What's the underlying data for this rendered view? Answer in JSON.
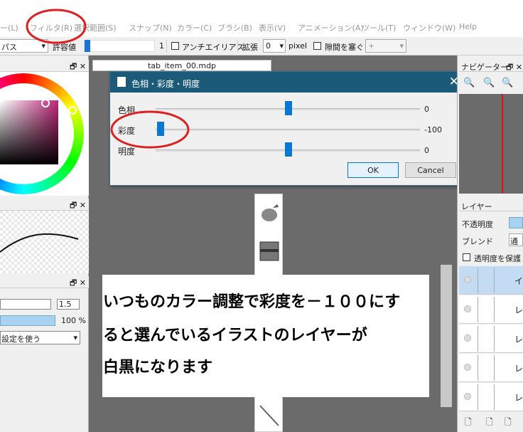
{
  "menubar": {
    "items": [
      "ー(L)",
      "フィルタ(R)",
      "選択範囲(S)",
      "スナップ(N)",
      "カラー(C)",
      "ブラシ(B)",
      "表示(V)",
      "アニメーション(A)",
      "ツール(T)",
      "ウィンドウ(W)",
      "Help"
    ]
  },
  "toolbar": {
    "mode_value": "パス",
    "tolerance_label": "許容値",
    "tolerance_value": "1",
    "antialias_label": "アンチエイリアス",
    "expand_label": "拡張",
    "expand_value": "0",
    "unit": "pixel",
    "gap_label": "隙間を塞ぐ",
    "gap_value": "+"
  },
  "left_panels": {
    "panel1_buttons": "🗗 ✕",
    "panel2_buttons": "🗗 ✕",
    "panel3_buttons": "🗗 ✕",
    "brush_size_value": "1.5",
    "opacity_value": "100 %",
    "setting_value": "設定を使う"
  },
  "document": {
    "tab_title": "tab_item_00.mdp"
  },
  "dialog": {
    "title": "色相・彩度・明度",
    "close_glyph": "✕",
    "rows": [
      {
        "label": "色相",
        "value": "0",
        "position": 0.5
      },
      {
        "label": "彩度",
        "value": "-100",
        "position": 0.0
      },
      {
        "label": "明度",
        "value": "0",
        "position": 0.5
      }
    ],
    "ok_label": "OK",
    "cancel_label": "Cancel"
  },
  "annotation": {
    "line1": "いつものカラー調整で彩度を－１００にす",
    "line2": "ると選んでいるイラストのレイヤーが",
    "line3": "白黒になります"
  },
  "right_panels": {
    "navigator_title": "ナビゲーター",
    "navigator_buttons": "🗗 ✕",
    "layer_title": "レイヤー",
    "opacity_label": "不透明度",
    "blend_label": "ブレンド",
    "blend_value": "通",
    "protect_label": "透明度を保護",
    "layers": [
      "イ",
      "レイ",
      "レイ",
      "レイ",
      "レイ"
    ]
  },
  "colors": {
    "dialog_title_bar": "#1b5a78",
    "slider_knob": "#0a76d6",
    "annotation_circle": "#dd1f1f",
    "canvas_bg": "#6b6b6b"
  }
}
